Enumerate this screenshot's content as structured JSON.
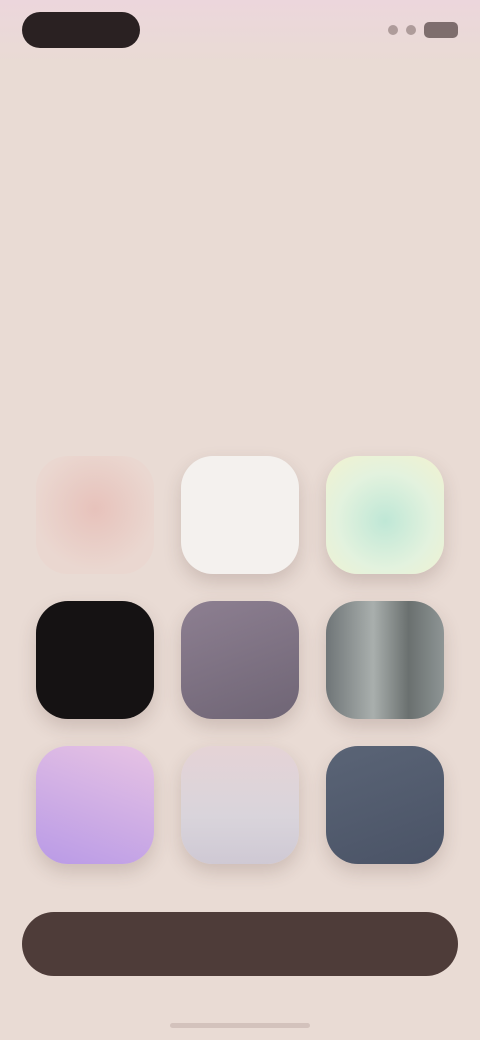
{
  "status_bar": {
    "icons": [
      "signal-icon",
      "wifi-icon",
      "battery-icon"
    ]
  },
  "hero": {
    "title": "",
    "subtitle": ""
  },
  "swatches": [
    {
      "name": "swatch-rose",
      "color": "#e7c2bb"
    },
    {
      "name": "swatch-white",
      "color": "#f4f1ee"
    },
    {
      "name": "swatch-mint",
      "color": "#bfe7d6"
    },
    {
      "name": "swatch-black",
      "color": "#151213"
    },
    {
      "name": "swatch-purple-gray",
      "color": "#8d7f91"
    },
    {
      "name": "swatch-silver",
      "color": "#a9afad"
    },
    {
      "name": "swatch-lavender",
      "color": "#b99ae6"
    },
    {
      "name": "swatch-pale",
      "color": "#e5d3d6"
    },
    {
      "name": "swatch-slate",
      "color": "#5a6476"
    }
  ],
  "cta": {
    "label": ""
  },
  "colors": {
    "background": "#e9dbd4",
    "primary_button": "#4e3c39"
  }
}
